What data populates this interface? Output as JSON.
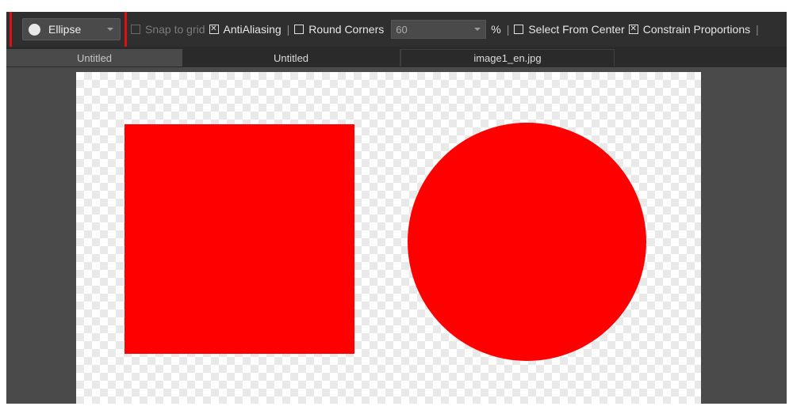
{
  "toolbar": {
    "shape_select": {
      "value": "Ellipse",
      "icon": "circle-icon"
    },
    "snap_to_grid": {
      "label": "Snap to grid",
      "checked": false,
      "enabled": false
    },
    "anti_aliasing": {
      "label": "AntiAliasing",
      "checked": true
    },
    "separator": "|",
    "round_corners": {
      "label": "Round Corners",
      "checked": false,
      "value": "60",
      "unit": "%"
    },
    "select_from_center": {
      "label": "Select From Center",
      "checked": false
    },
    "constrain_proportions": {
      "label": "Constrain Proportions",
      "checked": true
    }
  },
  "tabs": [
    {
      "label": "Untitled",
      "active": true
    },
    {
      "label": "Untitled",
      "active": false
    },
    {
      "label": "image1_en.jpg",
      "active": false
    }
  ],
  "canvas": {
    "background": "transparent-checkerboard",
    "shapes": [
      {
        "type": "square",
        "color": "#ff0000"
      },
      {
        "type": "circle",
        "color": "#ff0000"
      }
    ]
  },
  "highlight_color": "#e01010"
}
